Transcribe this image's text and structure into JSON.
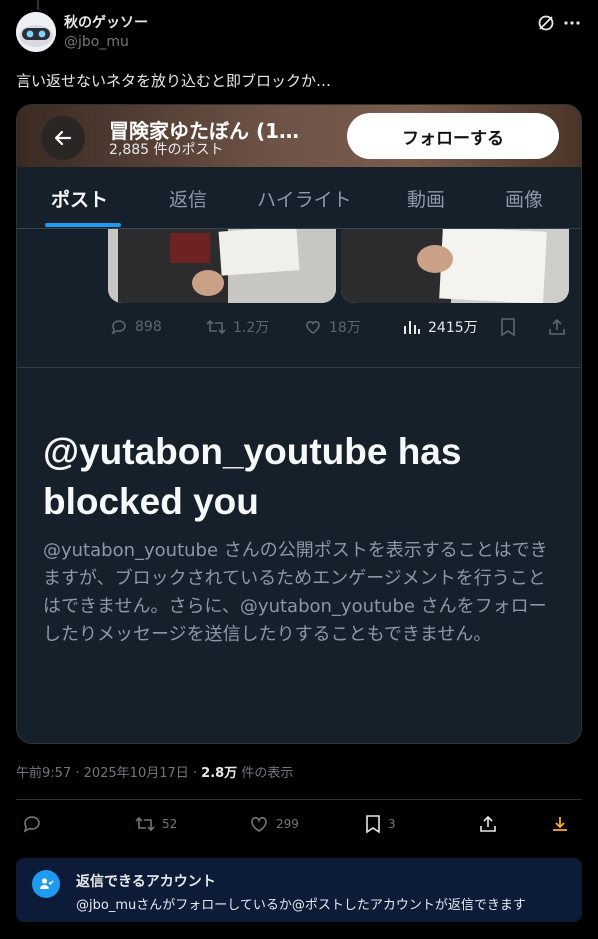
{
  "author": {
    "name": "秋のゲッソー",
    "handle": "@jbo_mu"
  },
  "post": {
    "text": "言い返せないネタを放り込むと即ブロックか…"
  },
  "embedded": {
    "profile_name": "冒険家ゆたぼん (1…",
    "posts_count": "2,885 件のポスト",
    "follow_label": "フォローする",
    "tabs": [
      "ポスト",
      "返信",
      "ハイライト",
      "動画",
      "画像"
    ],
    "stats": {
      "replies": "898",
      "reposts": "1.2万",
      "likes": "18万",
      "views": "2415万"
    },
    "blocked_title": "@yutabon_youtube has blocked you",
    "blocked_body": "@yutabon_youtube さんの公開ポストを表示することはできますが、ブロックされているためエンゲージメントを行うことはできません。さらに、@yutabon_youtube さんをフォローしたりメッセージを送信したりすることもできません。"
  },
  "meta": {
    "time": "午前9:57 · 2025年10月17日 · ",
    "views_count": "2.8万",
    "views_suffix": " 件の表示"
  },
  "actions": {
    "reposts": "52",
    "likes": "299",
    "bookmarks": "3"
  },
  "reply_notice": {
    "title": "返信できるアカウント",
    "description": "@jbo_muさんがフォローしているか@ポストしたアカウントが返信できます"
  },
  "colors": {
    "accent": "#1d9bf0",
    "download": "#ffad1f",
    "embedded_bg": "#15202b"
  }
}
